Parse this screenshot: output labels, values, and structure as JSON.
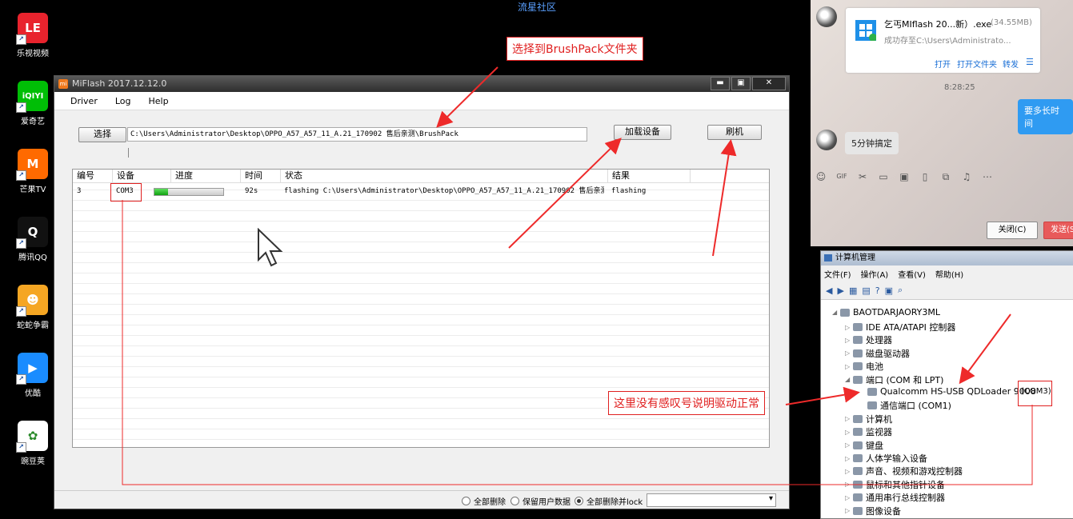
{
  "top_caption": "流星社区",
  "desktop": {
    "icons": [
      {
        "label": "乐视视频",
        "glyph": "LE",
        "color": "#e8232d",
        "icon": "letv-icon"
      },
      {
        "label": "爱奇艺",
        "glyph": "iQIYI",
        "color": "#00be06",
        "icon": "iqiyi-icon"
      },
      {
        "label": "芒果TV",
        "glyph": "M",
        "color": "#ff6a00",
        "icon": "mango-tv-icon"
      },
      {
        "label": "腾讯QQ",
        "glyph": "Q",
        "color": "#111111",
        "icon": "qq-penguin-icon"
      },
      {
        "label": "蛇蛇争霸",
        "glyph": "☻",
        "color": "#f5a623",
        "icon": "snake-game-icon"
      },
      {
        "label": "优酷",
        "glyph": "▶",
        "color": "#1a8cff",
        "icon": "youku-icon"
      },
      {
        "label": "豌豆荚",
        "glyph": "✿",
        "color": "#ffffff",
        "icon": "wandoujia-icon"
      }
    ]
  },
  "miflash": {
    "title": "MiFlash 2017.12.12.0",
    "window_buttons": {
      "minimize": "▬",
      "maximize": "▣",
      "close": "✕"
    },
    "menu": [
      "Driver",
      "Log",
      "Help"
    ],
    "select_button": "选择",
    "path": "C:\\Users\\Administrator\\Desktop\\OPPO_A57_A57_11_A.21_170902 售后亲测\\BrushPack",
    "load_device_button": "加载设备",
    "flash_button": "刷机",
    "columns": [
      "编号",
      "设备",
      "进度",
      "时间",
      "状态",
      "结果"
    ],
    "rows": [
      {
        "id": "3",
        "device": "COM3",
        "progress": 0.2,
        "time": "92s",
        "status": "flashing C:\\Users\\Administrator\\Desktop\\OPPO_A57_A57_11_A.21_170902 售后亲测\\B...",
        "result": "flashing"
      }
    ],
    "radio_options": [
      {
        "label": "全部删除",
        "checked": false
      },
      {
        "label": "保留用户数据",
        "checked": false
      },
      {
        "label": "全部删除并lock",
        "checked": true
      }
    ],
    "dropdown_value": ""
  },
  "annotations": {
    "callout_top": "选择到BrushPack文件夹",
    "callout_bottom": "这里没有感叹号说明驱动正常",
    "color": "#e02020"
  },
  "chat": {
    "file_name": "乞丐MIflash 20...新）.exe",
    "file_size": "(34.55MB)",
    "file_status": "成功存至C:\\Users\\Administrato...",
    "file_actions": [
      "打开",
      "打开文件夹",
      "转发"
    ],
    "time": "8:28:25",
    "msg_right": "要多长时间",
    "msg_left": "5分钟搞定",
    "toolbar_icons": [
      "smiley-icon",
      "gif-icon",
      "scissors-icon",
      "folder-icon",
      "image-icon",
      "phone-icon",
      "screenshot-icon",
      "music-icon",
      "more-icon"
    ],
    "close_button": "关闭(C)",
    "send_button": "发送(S"
  },
  "computer_management": {
    "title": "计算机管理",
    "menu": [
      "文件(F)",
      "操作(A)",
      "查看(V)",
      "帮助(H)"
    ],
    "root": "BAOTDARJAORY3ML",
    "tree": [
      {
        "label": "IDE ATA/ATAPI 控制器",
        "level": 1,
        "expander": "▷"
      },
      {
        "label": "处理器",
        "level": 1,
        "expander": "▷"
      },
      {
        "label": "磁盘驱动器",
        "level": 1,
        "expander": "▷"
      },
      {
        "label": "电池",
        "level": 1,
        "expander": "▷"
      },
      {
        "label": "端口 (COM 和 LPT)",
        "level": 1,
        "expander": "◢"
      },
      {
        "label": "Qualcomm HS-USB QDLoader 9008",
        "level": 2,
        "expander": ""
      },
      {
        "label": "通信端口 (COM1)",
        "level": 2,
        "expander": ""
      },
      {
        "label": "计算机",
        "level": 1,
        "expander": "▷"
      },
      {
        "label": "监视器",
        "level": 1,
        "expander": "▷"
      },
      {
        "label": "键盘",
        "level": 1,
        "expander": "▷"
      },
      {
        "label": "人体学输入设备",
        "level": 1,
        "expander": "▷"
      },
      {
        "label": "声音、视频和游戏控制器",
        "level": 1,
        "expander": "▷"
      },
      {
        "label": "鼠标和其他指针设备",
        "level": 1,
        "expander": "▷"
      },
      {
        "label": "通用串行总线控制器",
        "level": 1,
        "expander": "▷"
      },
      {
        "label": "图像设备",
        "level": 1,
        "expander": "▷"
      }
    ],
    "com_label": "(COM3)"
  }
}
